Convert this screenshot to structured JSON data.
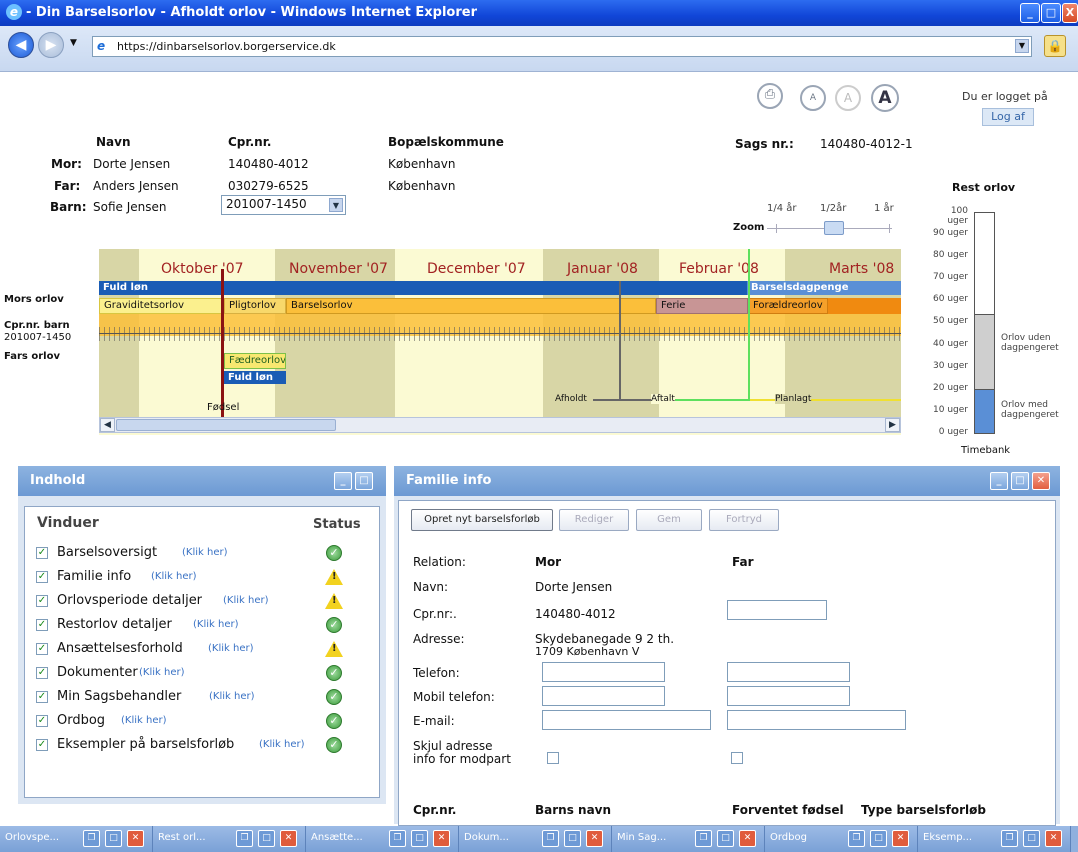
{
  "window": {
    "title": "- Din Barselsorlov - Afholdt orlov - Windows Internet Explorer",
    "buttons": [
      "_",
      "□",
      "X"
    ]
  },
  "address": {
    "url": "https://dinbarselsorlov.borgerservice.dk"
  },
  "toolbar": {
    "font_small": "A",
    "font_medium": "A",
    "font_large": "A"
  },
  "login": {
    "status": "Du er logget på",
    "logout": "Log af"
  },
  "family": {
    "headers": {
      "name": "Navn",
      "cpr": "Cpr.nr.",
      "municipality": "Bopælskommune"
    },
    "rows": [
      {
        "role": "Mor:",
        "name": "Dorte Jensen",
        "cpr": "140480-4012",
        "municipality": "København"
      },
      {
        "role": "Far:",
        "name": "Anders Jensen",
        "cpr": "030279-6525",
        "municipality": "København"
      }
    ],
    "child": {
      "role": "Barn:",
      "name": "Sofie Jensen",
      "cpr_selected": "201007-1450"
    },
    "case_label": "Sags nr.:",
    "case_number": "140480-4012-1"
  },
  "zoom": {
    "label": "Zoom",
    "options": [
      "1/4 år",
      "1/2år",
      "1 år"
    ]
  },
  "timeline": {
    "months": [
      "Oktober '07",
      "November '07",
      "December '07",
      "Januar '08",
      "Februar '08",
      "Marts '08"
    ],
    "row_labels": {
      "mother": "Mors orlov",
      "child_cpr_label": "Cpr.nr. barn",
      "child_cpr": "201007-1450",
      "father": "Fars orlov"
    },
    "bars": {
      "fuld_lon_top": "Fuld løn",
      "barselsdagpenge": "Barselsdagpenge",
      "graviditetsorlov": "Graviditetsorlov",
      "pligtorlov": "Pligtorlov",
      "barselsorlov": "Barselsorlov",
      "ferie": "Ferie",
      "foraeldreorlov": "Forældreorlov",
      "faedreorlov": "Fædreorlov",
      "fuld_lon_father": "Fuld løn"
    },
    "markers": {
      "birth": "Fødsel",
      "afholdt": "Afholdt",
      "aftalt": "Aftalt",
      "planlagt": "Planlagt"
    }
  },
  "rest": {
    "title": "Rest orlov",
    "ticks": [
      "100 uger",
      "90 uger",
      "80 uger",
      "70 uger",
      "60 uger",
      "50 uger",
      "40 uger",
      "30 uger",
      "20 uger",
      "10 uger",
      "0 uger"
    ],
    "legend": {
      "without": "Orlov uden dagpengeret",
      "with": "Orlov med dagpengeret"
    },
    "timebank": "Timebank",
    "levels_weeks": {
      "with_pay": 20,
      "without_pay": 34
    }
  },
  "indhold": {
    "title": "Indhold",
    "col_windows": "Vinduer",
    "col_status": "Status",
    "link_text": "(Klik her)",
    "items": [
      {
        "label": "Barselsoversigt",
        "status": "ok"
      },
      {
        "label": "Familie info",
        "status": "warn"
      },
      {
        "label": "Orlovsperiode detaljer",
        "status": "warn"
      },
      {
        "label": "Restorlov detaljer",
        "status": "ok"
      },
      {
        "label": "Ansættelsesforhold",
        "status": "warn"
      },
      {
        "label": "Dokumenter",
        "status": "ok"
      },
      {
        "label": "Min Sagsbehandler",
        "status": "ok"
      },
      {
        "label": "Ordbog",
        "status": "ok"
      },
      {
        "label": "Eksempler på barselsforløb",
        "status": "ok"
      }
    ]
  },
  "familie_info": {
    "title": "Familie info",
    "buttons": {
      "new": "Opret nyt barselsforløb",
      "edit": "Rediger",
      "save": "Gem",
      "cancel": "Fortryd"
    },
    "labels": {
      "relation": "Relation:",
      "name": "Navn:",
      "cpr": "Cpr.nr:.",
      "address": "Adresse:",
      "phone": "Telefon:",
      "mobile": "Mobil telefon:",
      "email": "E-mail:",
      "hide1": "Skjul adresse",
      "hide2": "info for modpart"
    },
    "mother": {
      "header": "Mor",
      "name": "Dorte Jensen",
      "cpr": "140480-4012",
      "address1": "Skydebanegade 9 2 th.",
      "address2": "1709 København V"
    },
    "father": {
      "header": "Far"
    },
    "bottom_headers": {
      "cpr": "Cpr.nr.",
      "child_name": "Barns navn",
      "due": "Forventet fødsel",
      "type": "Type barselsforløb"
    }
  },
  "taskbar": {
    "items": [
      "Orlovspe...",
      "Rest orl...",
      "Ansætte...",
      "Dokum...",
      "Min Sag...",
      "Ordbog",
      "Eksemp..."
    ]
  }
}
